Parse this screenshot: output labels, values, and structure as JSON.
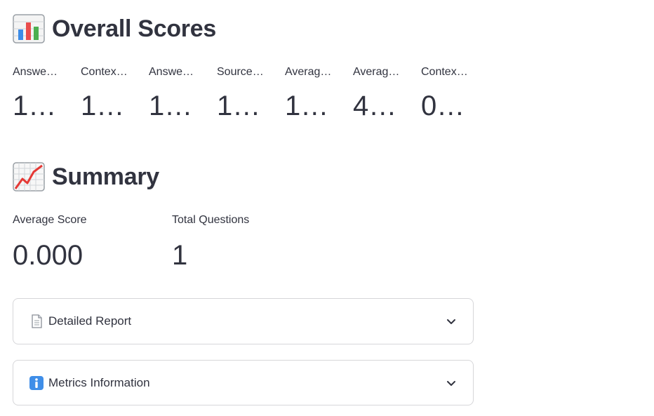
{
  "overall": {
    "heading_icon": "bar-chart-icon",
    "title": "Overall Scores",
    "metrics": [
      {
        "label": "Answe…",
        "value": "1…"
      },
      {
        "label": "Contex…",
        "value": "1…"
      },
      {
        "label": "Answe…",
        "value": "1…"
      },
      {
        "label": "Source…",
        "value": "1…"
      },
      {
        "label": "Averag…",
        "value": "1…"
      },
      {
        "label": "Averag…",
        "value": "4…"
      },
      {
        "label": "Contex…",
        "value": "0…"
      }
    ]
  },
  "summary": {
    "heading_icon": "line-chart-icon",
    "title": "Summary",
    "average_score": {
      "label": "Average Score",
      "value": "0.000"
    },
    "total_questions": {
      "label": "Total Questions",
      "value": "1"
    }
  },
  "expanders": [
    {
      "icon": "document-icon",
      "label": "Detailed Report"
    },
    {
      "icon": "info-icon",
      "label": "Metrics Information"
    }
  ],
  "colors": {
    "text": "#31333f",
    "border": "#d6d6d9",
    "background": "#ffffff"
  }
}
